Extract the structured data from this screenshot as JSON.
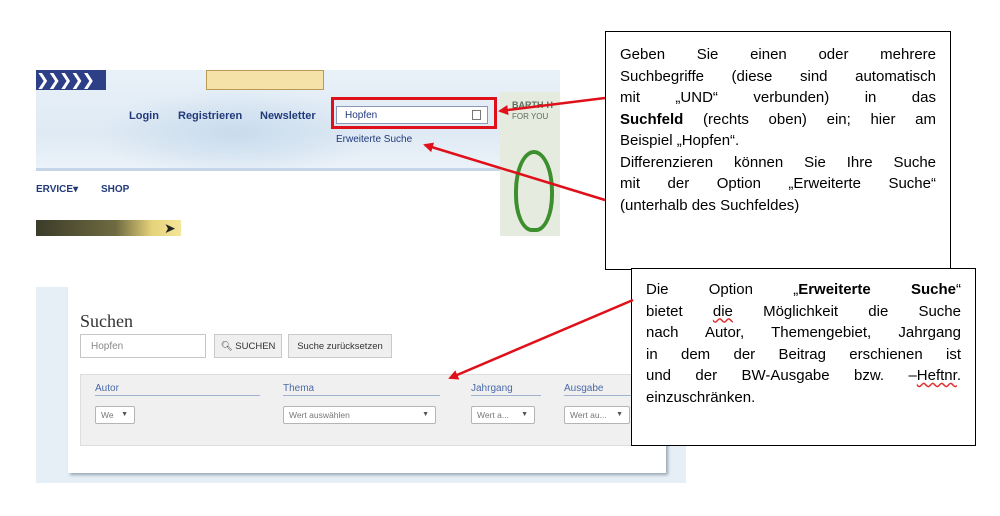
{
  "top_screenshot": {
    "nav": {
      "login": "Login",
      "register": "Registrieren",
      "newsletter": "Newsletter"
    },
    "search": {
      "value": "Hopfen",
      "calendar_icon": "calendar-icon",
      "advanced_link": "Erweiterte Suche"
    },
    "menu": {
      "service": "ERVICE",
      "service_caret": "▾",
      "shop": "SHOP"
    },
    "sidebar_banner": {
      "text_line1": "BARTH-H",
      "text_line2": "FOR YOU"
    }
  },
  "bottom_screenshot": {
    "heading": "Suchen",
    "search_input_value": "Hopfen",
    "search_button": "SUCHEN",
    "search_button_icon": "search-icon",
    "reset_button": "Suche zurücksetzen",
    "filters": [
      {
        "label": "Autor",
        "select_value": "We"
      },
      {
        "label": "Thema",
        "select_value": "Wert auswählen"
      },
      {
        "label": "Jahrgang",
        "select_value": "Wert a..."
      },
      {
        "label": "Ausgabe",
        "select_value": "Wert au..."
      }
    ]
  },
  "callout1": {
    "l1": "Geben Sie einen oder mehrere",
    "l2": "Suchbegriffe (diese sind automatisch",
    "l3": "mit „UND“ verbunden) in das",
    "l4_bold": "Suchfeld",
    "l4_rest": " (rechts oben) ein; hier am",
    "l5": "Beispiel „Hopfen“.",
    "l6": "Differenzieren können Sie Ihre Suche",
    "l7": "mit der Option „Erweiterte Suche“",
    "l8": "(unterhalb des Suchfeldes)"
  },
  "callout2": {
    "l1_pre": "Die Option „",
    "l1_bold": "Erweiterte Suche",
    "l1_post": "“",
    "l2_pre": "bietet ",
    "l2_wavy": "die",
    "l2_post": " Möglichkeit die Suche",
    "l3": "nach Autor, Themengebiet, Jahrgang",
    "l4": "in dem der Beitrag erschienen ist",
    "l5_pre": "und der BW-Ausgabe bzw. –",
    "l5_wavy": "Heftnr",
    "l5_post": ".",
    "l6": "einzuschränken."
  },
  "colors": {
    "highlight_red": "#e0101a",
    "nav_blue": "#223a7a",
    "label_blue": "#4a6aa8"
  }
}
